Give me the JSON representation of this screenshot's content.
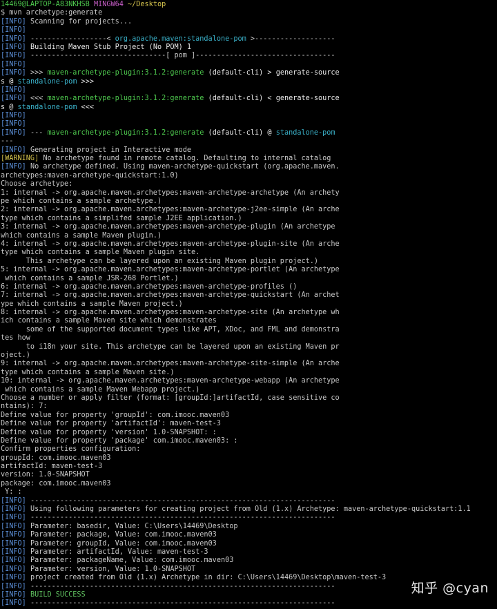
{
  "colors": {
    "background": "#000000",
    "text": "#c0c0c0",
    "prompt_user": "#4ec94e",
    "prompt_env": "#c45cc4",
    "prompt_path": "#d6c44e",
    "info_tag": "#5b8fd8",
    "plugin": "#4ec94e",
    "pom": "#3ab0c8",
    "warning_tag": "#d6c44e",
    "success": "#5fc05f"
  },
  "watermark": "知乎 @cyan",
  "lines": [
    [
      {
        "t": "14469@LAPTOP-A83NKHSB ",
        "c": "green"
      },
      {
        "t": "MINGW64 ",
        "c": "magenta"
      },
      {
        "t": "~/Desktop",
        "c": "yellow"
      }
    ],
    [
      {
        "t": "$ mvn archetype:generate",
        "c": "default"
      }
    ],
    [
      {
        "t": "[INFO]",
        "c": "blue"
      },
      {
        "t": " Scanning for projects...",
        "c": "default"
      }
    ],
    [
      {
        "t": "[INFO]",
        "c": "blue"
      }
    ],
    [
      {
        "t": "[INFO]",
        "c": "blue"
      },
      {
        "t": " ------------------< ",
        "c": "default"
      },
      {
        "t": "org.apache.maven:standalone-pom",
        "c": "cyan"
      },
      {
        "t": " >-------------------",
        "c": "default"
      }
    ],
    [
      {
        "t": "[INFO]",
        "c": "blue"
      },
      {
        "t": " Building Maven Stub Project (No POM) 1",
        "c": "white"
      }
    ],
    [
      {
        "t": "[INFO]",
        "c": "blue"
      },
      {
        "t": " --------------------------------[ pom ]---------------------------------",
        "c": "default"
      }
    ],
    [
      {
        "t": "[INFO]",
        "c": "blue"
      }
    ],
    [
      {
        "t": "[INFO]",
        "c": "blue"
      },
      {
        "t": " >>> ",
        "c": "default"
      },
      {
        "t": "maven-archetype-plugin:3.1.2:generate",
        "c": "green"
      },
      {
        "t": " (default-cli) > generate-source",
        "c": "white"
      }
    ],
    [
      {
        "t": "s @ ",
        "c": "white"
      },
      {
        "t": "standalone-pom",
        "c": "cyan"
      },
      {
        "t": " >>>",
        "c": "white"
      }
    ],
    [
      {
        "t": "[INFO]",
        "c": "blue"
      }
    ],
    [
      {
        "t": "[INFO]",
        "c": "blue"
      },
      {
        "t": " <<< ",
        "c": "default"
      },
      {
        "t": "maven-archetype-plugin:3.1.2:generate",
        "c": "green"
      },
      {
        "t": " (default-cli) < generate-source",
        "c": "white"
      }
    ],
    [
      {
        "t": "s @ ",
        "c": "white"
      },
      {
        "t": "standalone-pom",
        "c": "cyan"
      },
      {
        "t": " <<<",
        "c": "white"
      }
    ],
    [
      {
        "t": "[INFO]",
        "c": "blue"
      }
    ],
    [
      {
        "t": "[INFO]",
        "c": "blue"
      }
    ],
    [
      {
        "t": "[INFO]",
        "c": "blue"
      },
      {
        "t": " --- ",
        "c": "default"
      },
      {
        "t": "maven-archetype-plugin:3.1.2:generate",
        "c": "green"
      },
      {
        "t": " (default-cli) @ ",
        "c": "white"
      },
      {
        "t": "standalone-pom",
        "c": "cyan"
      }
    ],
    [
      {
        "t": "---",
        "c": "default"
      }
    ],
    [
      {
        "t": "[INFO]",
        "c": "blue"
      },
      {
        "t": " Generating project in Interactive mode",
        "c": "default"
      }
    ],
    [
      {
        "t": "[WARNING]",
        "c": "yellow"
      },
      {
        "t": " No archetype found in remote catalog. Defaulting to internal catalog",
        "c": "default"
      }
    ],
    [
      {
        "t": "[INFO]",
        "c": "blue"
      },
      {
        "t": " No archetype defined. Using maven-archetype-quickstart (org.apache.maven.",
        "c": "default"
      }
    ],
    [
      {
        "t": "archetypes:maven-archetype-quickstart:1.0)",
        "c": "default"
      }
    ],
    [
      {
        "t": "Choose archetype:",
        "c": "default"
      }
    ],
    [
      {
        "t": "1: internal -> org.apache.maven.archetypes:maven-archetype-archetype (An archety",
        "c": "default"
      }
    ],
    [
      {
        "t": "pe which contains a sample archetype.)",
        "c": "default"
      }
    ],
    [
      {
        "t": "2: internal -> org.apache.maven.archetypes:maven-archetype-j2ee-simple (An arche",
        "c": "default"
      }
    ],
    [
      {
        "t": "type which contains a simplifed sample J2EE application.)",
        "c": "default"
      }
    ],
    [
      {
        "t": "3: internal -> org.apache.maven.archetypes:maven-archetype-plugin (An archetype",
        "c": "default"
      }
    ],
    [
      {
        "t": "which contains a sample Maven plugin.)",
        "c": "default"
      }
    ],
    [
      {
        "t": "4: internal -> org.apache.maven.archetypes:maven-archetype-plugin-site (An arche",
        "c": "default"
      }
    ],
    [
      {
        "t": "type which contains a sample Maven plugin site.",
        "c": "default"
      }
    ],
    [
      {
        "t": "      This archetype can be layered upon an existing Maven plugin project.)",
        "c": "default"
      }
    ],
    [
      {
        "t": "5: internal -> org.apache.maven.archetypes:maven-archetype-portlet (An archetype",
        "c": "default"
      }
    ],
    [
      {
        "t": " which contains a sample JSR-268 Portlet.)",
        "c": "default"
      }
    ],
    [
      {
        "t": "6: internal -> org.apache.maven.archetypes:maven-archetype-profiles ()",
        "c": "default"
      }
    ],
    [
      {
        "t": "7: internal -> org.apache.maven.archetypes:maven-archetype-quickstart (An archet",
        "c": "default"
      }
    ],
    [
      {
        "t": "ype which contains a sample Maven project.)",
        "c": "default"
      }
    ],
    [
      {
        "t": "8: internal -> org.apache.maven.archetypes:maven-archetype-site (An archetype wh",
        "c": "default"
      }
    ],
    [
      {
        "t": "ich contains a sample Maven site which demonstrates",
        "c": "default"
      }
    ],
    [
      {
        "t": "      some of the supported document types like APT, XDoc, and FML and demonstra",
        "c": "default"
      }
    ],
    [
      {
        "t": "tes how",
        "c": "default"
      }
    ],
    [
      {
        "t": "      to i18n your site. This archetype can be layered upon an existing Maven pr",
        "c": "default"
      }
    ],
    [
      {
        "t": "oject.)",
        "c": "default"
      }
    ],
    [
      {
        "t": "9: internal -> org.apache.maven.archetypes:maven-archetype-site-simple (An arche",
        "c": "default"
      }
    ],
    [
      {
        "t": "type which contains a sample Maven site.)",
        "c": "default"
      }
    ],
    [
      {
        "t": "10: internal -> org.apache.maven.archetypes:maven-archetype-webapp (An archetype",
        "c": "default"
      }
    ],
    [
      {
        "t": " which contains a sample Maven Webapp project.)",
        "c": "default"
      }
    ],
    [
      {
        "t": "Choose a number or apply filter (format: [groupId:]artifactId, case sensitive co",
        "c": "default"
      }
    ],
    [
      {
        "t": "ntains): 7:",
        "c": "default"
      }
    ],
    [
      {
        "t": "Define value for property 'groupId': com.imooc.maven03",
        "c": "default"
      }
    ],
    [
      {
        "t": "Define value for property 'artifactId': maven-test-3",
        "c": "default"
      }
    ],
    [
      {
        "t": "Define value for property 'version' 1.0-SNAPSHOT: :",
        "c": "default"
      }
    ],
    [
      {
        "t": "Define value for property 'package' com.imooc.maven03: :",
        "c": "default"
      }
    ],
    [
      {
        "t": "Confirm properties configuration:",
        "c": "default"
      }
    ],
    [
      {
        "t": "groupId: com.imooc.maven03",
        "c": "default"
      }
    ],
    [
      {
        "t": "artifactId: maven-test-3",
        "c": "default"
      }
    ],
    [
      {
        "t": "version: 1.0-SNAPSHOT",
        "c": "default"
      }
    ],
    [
      {
        "t": "package: com.imooc.maven03",
        "c": "default"
      }
    ],
    [
      {
        "t": " Y: :",
        "c": "default"
      }
    ],
    [
      {
        "t": "[INFO]",
        "c": "blue"
      },
      {
        "t": " ------------------------------------------------------------------------",
        "c": "default"
      }
    ],
    [
      {
        "t": "[INFO]",
        "c": "blue"
      },
      {
        "t": " Using following parameters for creating project from Old (1.x) Archetype: maven-archetype-quickstart:1.1",
        "c": "default"
      }
    ],
    [
      {
        "t": "[INFO]",
        "c": "blue"
      },
      {
        "t": " ------------------------------------------------------------------------",
        "c": "default"
      }
    ],
    [
      {
        "t": "[INFO]",
        "c": "blue"
      },
      {
        "t": " Parameter: basedir, Value: C:\\Users\\14469\\Desktop",
        "c": "default"
      }
    ],
    [
      {
        "t": "[INFO]",
        "c": "blue"
      },
      {
        "t": " Parameter: package, Value: com.imooc.maven03",
        "c": "default"
      }
    ],
    [
      {
        "t": "[INFO]",
        "c": "blue"
      },
      {
        "t": " Parameter: groupId, Value: com.imooc.maven03",
        "c": "default"
      }
    ],
    [
      {
        "t": "[INFO]",
        "c": "blue"
      },
      {
        "t": " Parameter: artifactId, Value: maven-test-3",
        "c": "default"
      }
    ],
    [
      {
        "t": "[INFO]",
        "c": "blue"
      },
      {
        "t": " Parameter: packageName, Value: com.imooc.maven03",
        "c": "default"
      }
    ],
    [
      {
        "t": "[INFO]",
        "c": "blue"
      },
      {
        "t": " Parameter: version, Value: 1.0-SNAPSHOT",
        "c": "default"
      }
    ],
    [
      {
        "t": "[INFO]",
        "c": "blue"
      },
      {
        "t": " project created from Old (1.x) Archetype in dir: C:\\Users\\14469\\Desktop\\maven-test-3",
        "c": "default"
      }
    ],
    [
      {
        "t": "[INFO]",
        "c": "blue"
      },
      {
        "t": " ------------------------------------------------------------------------",
        "c": "default"
      }
    ],
    [
      {
        "t": "[INFO]",
        "c": "blue"
      },
      {
        "t": " BUILD SUCCESS",
        "c": "green2"
      }
    ],
    [
      {
        "t": "[INFO]",
        "c": "blue"
      },
      {
        "t": " ------------------------------------------------------------------------",
        "c": "default"
      }
    ]
  ]
}
